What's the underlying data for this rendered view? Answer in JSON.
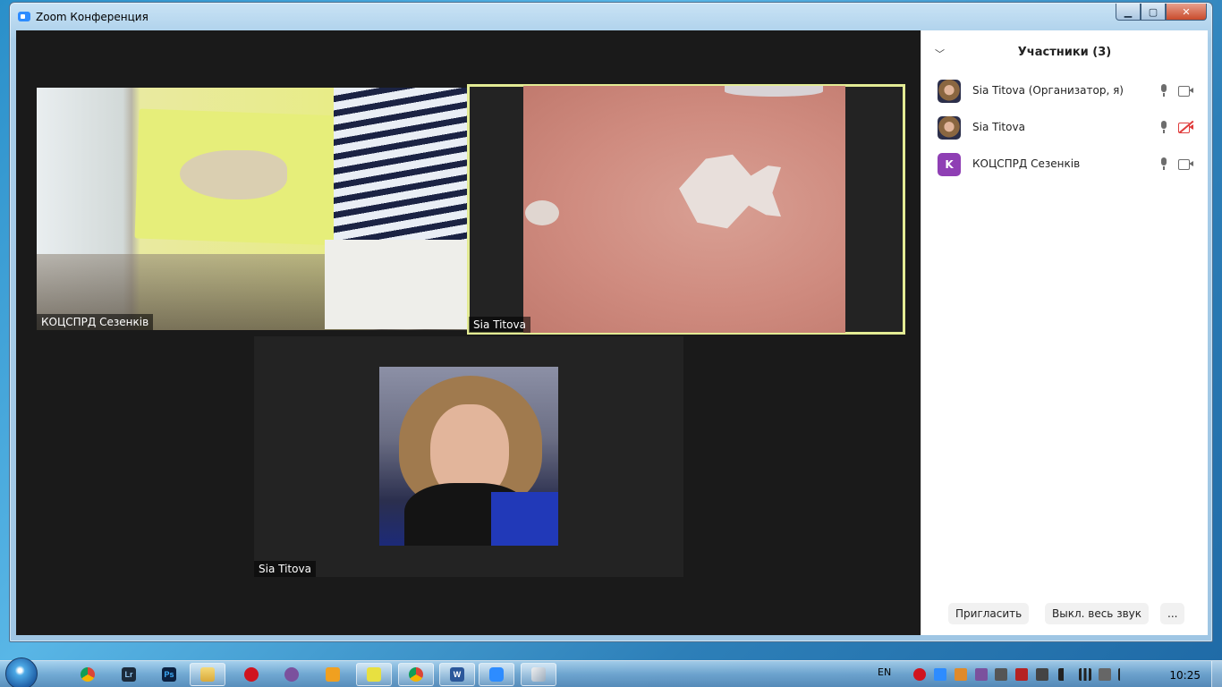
{
  "window": {
    "title": "Zoom Конференция",
    "controls": {
      "minimize": "▁",
      "maximize": "▢",
      "close": "✕"
    }
  },
  "videos": [
    {
      "name": "КОЦСПРД Сезенків",
      "active": false
    },
    {
      "name": "Sia Titova",
      "active": true
    },
    {
      "name": "Sia Titova",
      "active": false
    }
  ],
  "participants_panel": {
    "title": "Участники (3)",
    "collapse_icon": "chevron-down-icon",
    "participants": [
      {
        "name": "Sia Titova (Организатор, я)",
        "avatar": "photo",
        "mic": "on",
        "video": "on"
      },
      {
        "name": "Sia Titova",
        "avatar": "photo",
        "mic": "on",
        "video": "off"
      },
      {
        "name": "КОЦСПРД Сезенків",
        "avatar_letter": "K",
        "avatar_color": "#8f3fb4",
        "mic": "on",
        "video": "on"
      }
    ],
    "footer": {
      "invite": "Пригласить",
      "mute_all": "Выкл. весь звук",
      "more": "..."
    }
  },
  "taskbar": {
    "pinned": [
      {
        "icon": "chrome-icon",
        "label": ""
      },
      {
        "icon": "lightroom-icon",
        "label": "Lr"
      },
      {
        "icon": "photoshop-icon",
        "label": "Ps"
      },
      {
        "icon": "explorer-icon",
        "label": ""
      },
      {
        "icon": "opera-icon",
        "label": ""
      },
      {
        "icon": "viber-icon",
        "label": ""
      },
      {
        "icon": "media-player-icon",
        "label": ""
      },
      {
        "icon": "calendar-icon",
        "label": ""
      },
      {
        "icon": "chrome-icon",
        "label": ""
      },
      {
        "icon": "word-icon",
        "label": "W"
      },
      {
        "icon": "zoom-icon",
        "label": ""
      },
      {
        "icon": "paint-icon",
        "label": ""
      }
    ],
    "tray": {
      "language": "EN",
      "time": "10:25"
    }
  }
}
